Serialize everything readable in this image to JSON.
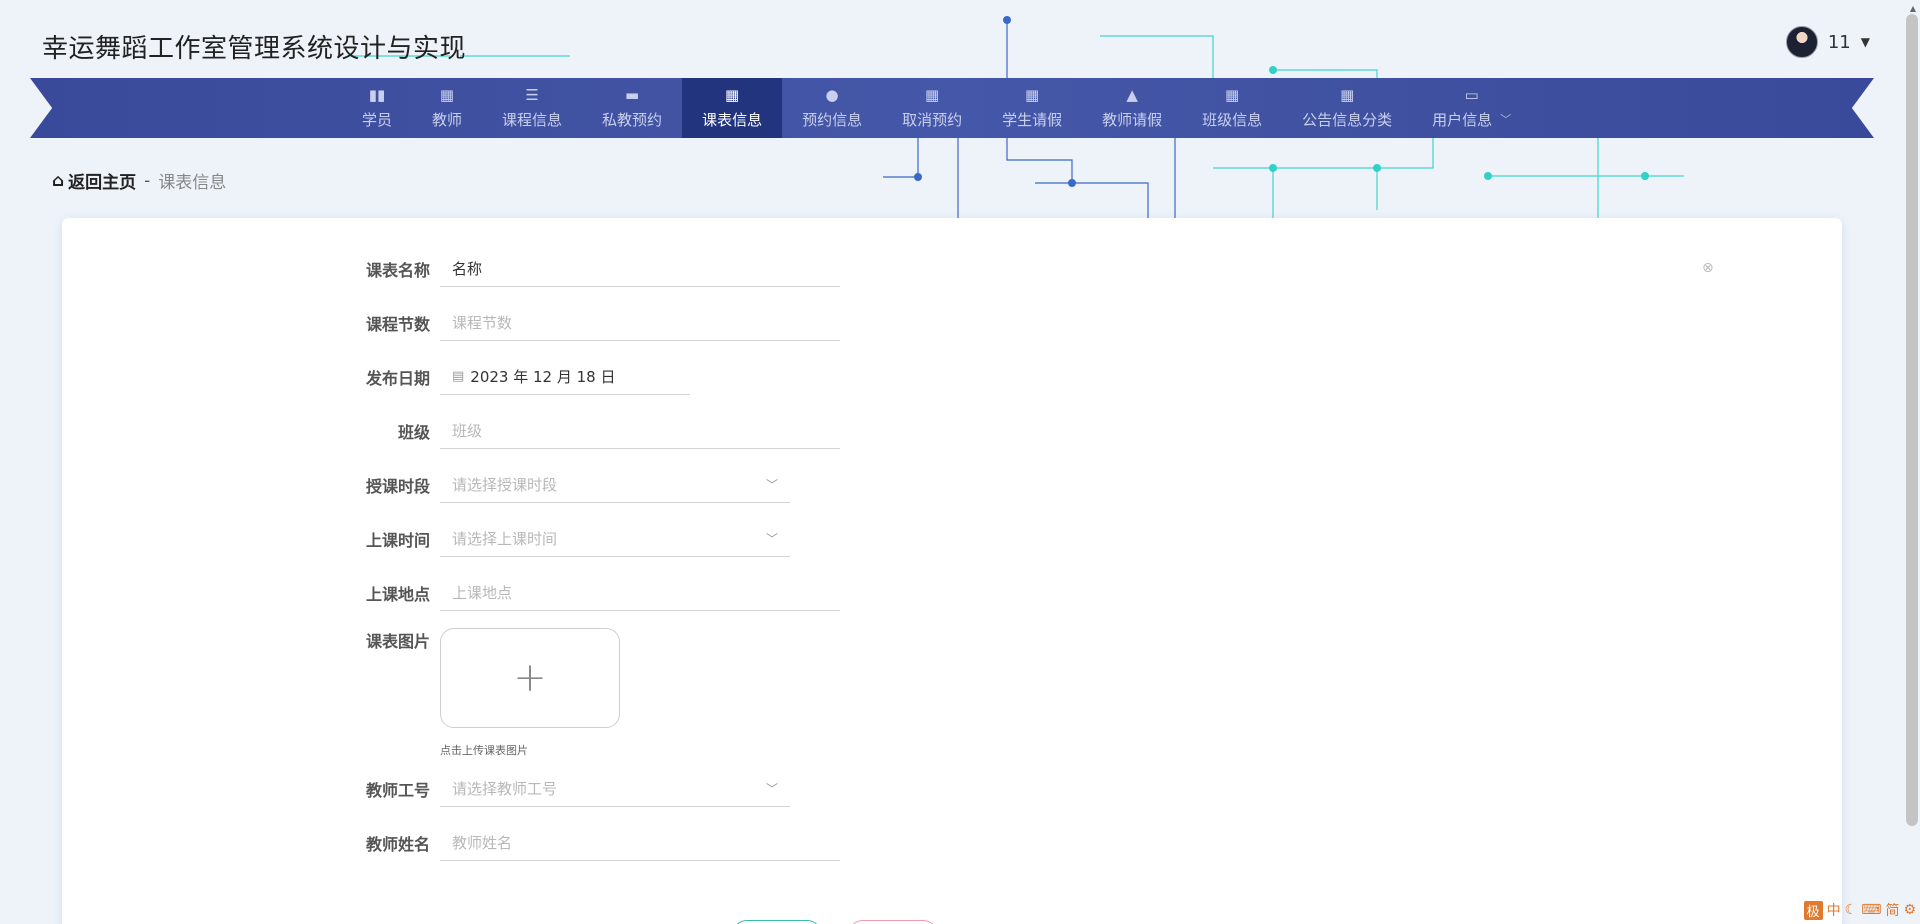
{
  "site": {
    "title": "幸运舞蹈工作室管理系统设计与实现"
  },
  "user": {
    "name": "11"
  },
  "nav": {
    "items": [
      {
        "label": "学员",
        "icon": "bar-chart-icon"
      },
      {
        "label": "教师",
        "icon": "grid-icon"
      },
      {
        "label": "课程信息",
        "icon": "list-icon"
      },
      {
        "label": "私教预约",
        "icon": "monitor-icon"
      },
      {
        "label": "课表信息",
        "icon": "grid-icon",
        "active": true
      },
      {
        "label": "预约信息",
        "icon": "pin-icon"
      },
      {
        "label": "取消预约",
        "icon": "grid-icon"
      },
      {
        "label": "学生请假",
        "icon": "grid-icon"
      },
      {
        "label": "教师请假",
        "icon": "person-icon"
      },
      {
        "label": "班级信息",
        "icon": "grid-icon"
      },
      {
        "label": "公告信息分类",
        "icon": "grid-icon"
      },
      {
        "label": "用户信息",
        "icon": "card-icon"
      }
    ]
  },
  "breadcrumb": {
    "home": "返回主页",
    "separator": "-",
    "current": "课表信息"
  },
  "form": {
    "name": {
      "label": "课表名称",
      "value": "名称",
      "placeholder": "名称"
    },
    "lessons": {
      "label": "课程节数",
      "placeholder": "课程节数"
    },
    "date": {
      "label": "发布日期",
      "value": "2023 年 12 月 18 日"
    },
    "class": {
      "label": "班级",
      "placeholder": "班级"
    },
    "period": {
      "label": "授课时段",
      "placeholder": "请选择授课时段"
    },
    "time": {
      "label": "上课时间",
      "placeholder": "请选择上课时间"
    },
    "location": {
      "label": "上课地点",
      "placeholder": "上课地点"
    },
    "image": {
      "label": "课表图片",
      "hint": "点击上传课表图片"
    },
    "teacher_id": {
      "label": "教师工号",
      "placeholder": "请选择教师工号"
    },
    "teacher_name": {
      "label": "教师姓名",
      "placeholder": "教师姓名"
    }
  },
  "ime": {
    "items": [
      "极",
      "中",
      "简"
    ]
  }
}
